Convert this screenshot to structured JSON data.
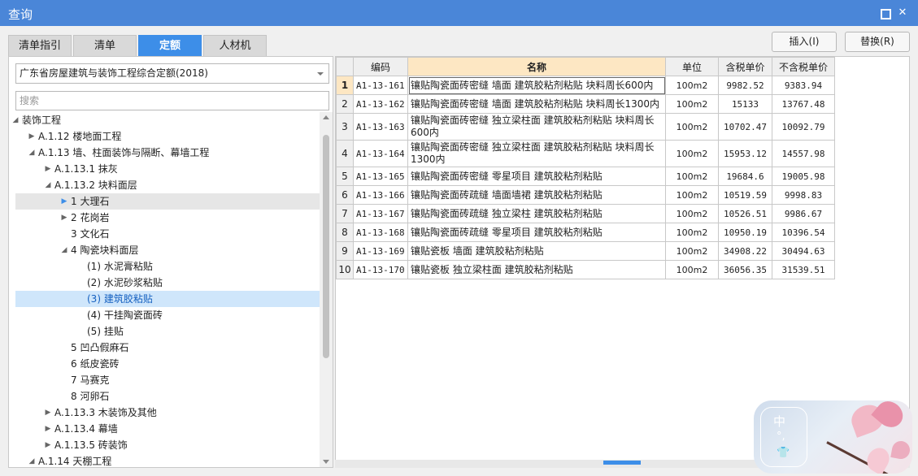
{
  "window": {
    "title": "查询",
    "close_glyph": "✕"
  },
  "tabs": [
    {
      "label": "清单指引",
      "active": false
    },
    {
      "label": "清单",
      "active": false
    },
    {
      "label": "定额",
      "active": true
    },
    {
      "label": "人材机",
      "active": false
    }
  ],
  "actions": {
    "insert": "插入(I)",
    "replace": "替换(R)"
  },
  "left": {
    "quota_select": "广东省房屋建筑与装饰工程综合定额(2018)",
    "search_placeholder": "搜索"
  },
  "tree": [
    {
      "text": "装饰工程",
      "level": 0,
      "toggle": "expanded"
    },
    {
      "text": "A.1.12 楼地面工程",
      "level": 1,
      "toggle": "collapsed"
    },
    {
      "text": "A.1.13 墙、柱面装饰与隔断、幕墙工程",
      "level": 1,
      "toggle": "expanded"
    },
    {
      "text": "A.1.13.1 抹灰",
      "level": 2,
      "toggle": "collapsed"
    },
    {
      "text": "A.1.13.2 块料面层",
      "level": 2,
      "toggle": "expanded"
    },
    {
      "text": "1 大理石",
      "level": 3,
      "toggle": "collapsed-active",
      "highlight": "gray"
    },
    {
      "text": "2 花岗岩",
      "level": 3,
      "toggle": "collapsed"
    },
    {
      "text": "3 文化石",
      "level": 3,
      "toggle": "none"
    },
    {
      "text": "4 陶瓷块料面层",
      "level": 3,
      "toggle": "expanded"
    },
    {
      "text": "(1) 水泥膏粘贴",
      "level": 4,
      "toggle": "none"
    },
    {
      "text": "(2) 水泥砂浆粘贴",
      "level": 4,
      "toggle": "none"
    },
    {
      "text": "(3) 建筑胶粘贴",
      "level": 4,
      "toggle": "none",
      "highlight": "blue"
    },
    {
      "text": "(4) 干挂陶瓷面砖",
      "level": 4,
      "toggle": "none"
    },
    {
      "text": "(5) 挂贴",
      "level": 4,
      "toggle": "none"
    },
    {
      "text": "5 凹凸假麻石",
      "level": 3,
      "toggle": "none"
    },
    {
      "text": "6 纸皮瓷砖",
      "level": 3,
      "toggle": "none"
    },
    {
      "text": "7 马赛克",
      "level": 3,
      "toggle": "none"
    },
    {
      "text": "8 河卵石",
      "level": 3,
      "toggle": "none"
    },
    {
      "text": "A.1.13.3 木装饰及其他",
      "level": 2,
      "toggle": "collapsed"
    },
    {
      "text": "A.1.13.4 幕墙",
      "level": 2,
      "toggle": "collapsed"
    },
    {
      "text": "A.1.13.5 砖装饰",
      "level": 2,
      "toggle": "collapsed"
    },
    {
      "text": "A.1.14 天棚工程",
      "level": 1,
      "toggle": "expanded"
    }
  ],
  "table": {
    "headers": {
      "rownum": "",
      "code": "编码",
      "name": "名称",
      "unit": "单位",
      "tax_price": "含税单价",
      "notax_price": "不含税单价"
    },
    "current_row": 0,
    "rows": [
      {
        "no": "1",
        "code": "A1-13-161",
        "name": "镶贴陶瓷面砖密缝 墙面 建筑胶粘剂粘贴 块料周长600内",
        "unit": "100m2",
        "tax_price": "9982.52",
        "notax_price": "9383.94"
      },
      {
        "no": "2",
        "code": "A1-13-162",
        "name": "镶贴陶瓷面砖密缝 墙面 建筑胶粘剂粘贴 块料周长1300内",
        "unit": "100m2",
        "tax_price": "15133",
        "notax_price": "13767.48"
      },
      {
        "no": "3",
        "code": "A1-13-163",
        "name": "镶贴陶瓷面砖密缝 独立梁柱面 建筑胶粘剂粘贴 块料周长600内",
        "unit": "100m2",
        "tax_price": "10702.47",
        "notax_price": "10092.79"
      },
      {
        "no": "4",
        "code": "A1-13-164",
        "name": "镶贴陶瓷面砖密缝 独立梁柱面 建筑胶粘剂粘贴 块料周长1300内",
        "unit": "100m2",
        "tax_price": "15953.12",
        "notax_price": "14557.98"
      },
      {
        "no": "5",
        "code": "A1-13-165",
        "name": "镶贴陶瓷面砖密缝 零星项目 建筑胶粘剂粘贴",
        "unit": "100m2",
        "tax_price": "19684.6",
        "notax_price": "19005.98"
      },
      {
        "no": "6",
        "code": "A1-13-166",
        "name": "镶贴陶瓷面砖疏缝 墙面墙裙 建筑胶粘剂粘贴",
        "unit": "100m2",
        "tax_price": "10519.59",
        "notax_price": "9998.83"
      },
      {
        "no": "7",
        "code": "A1-13-167",
        "name": "镶贴陶瓷面砖疏缝 独立梁柱 建筑胶粘剂粘贴",
        "unit": "100m2",
        "tax_price": "10526.51",
        "notax_price": "9986.67"
      },
      {
        "no": "8",
        "code": "A1-13-168",
        "name": "镶贴陶瓷面砖疏缝 零星项目 建筑胶粘剂粘贴",
        "unit": "100m2",
        "tax_price": "10950.19",
        "notax_price": "10396.54"
      },
      {
        "no": "9",
        "code": "A1-13-169",
        "name": "镶贴瓷板 墙面 建筑胶粘剂粘贴",
        "unit": "100m2",
        "tax_price": "34908.22",
        "notax_price": "30494.63"
      },
      {
        "no": "10",
        "code": "A1-13-170",
        "name": "镶贴瓷板 独立梁柱面 建筑胶粘剂粘贴",
        "unit": "100m2",
        "tax_price": "36056.35",
        "notax_price": "31539.51"
      }
    ]
  },
  "ime": {
    "mode_char": "中",
    "punct": "°,",
    "shirt": "👕"
  },
  "colors": {
    "titlebar": "#4a86d8",
    "tab_active": "#3d8ee8",
    "header_highlight": "#fde7c3",
    "tree_selected": "#cfe6fb"
  }
}
